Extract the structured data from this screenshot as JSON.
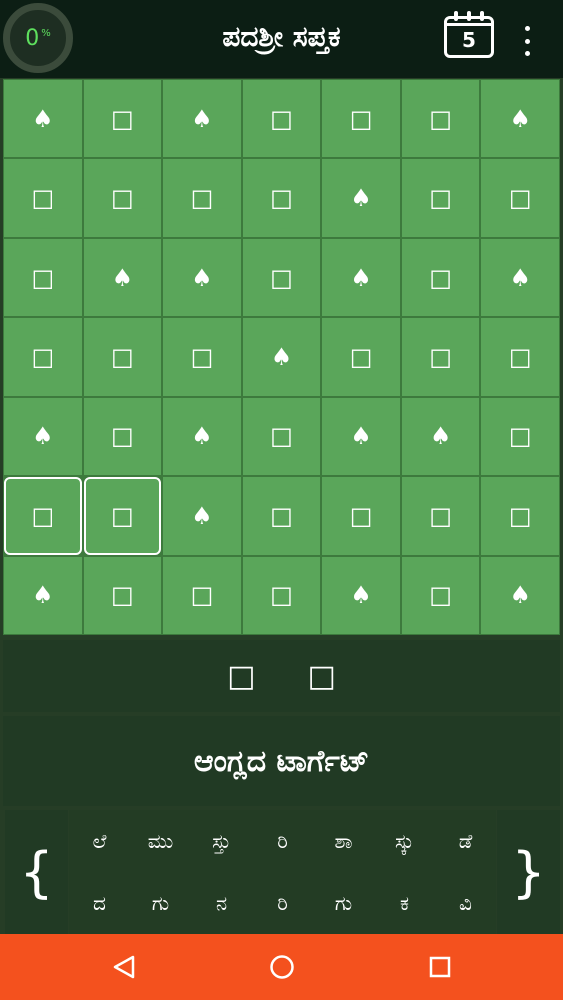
{
  "header": {
    "progress_value": "0",
    "progress_unit": "%",
    "title": "ಪದಶ್ರೀ ಸಪ್ತಕ",
    "calendar_day": "5"
  },
  "board": {
    "rows": [
      [
        "♠",
        "□",
        "♠",
        "□",
        "□",
        "□",
        "♠"
      ],
      [
        "□",
        "□",
        "□",
        "□",
        "♠",
        "□",
        "□"
      ],
      [
        "□",
        "♠",
        "♠",
        "□",
        "♠",
        "□",
        "♠"
      ],
      [
        "□",
        "□",
        "□",
        "♠",
        "□",
        "□",
        "□"
      ],
      [
        "♠",
        "□",
        "♠",
        "□",
        "♠",
        "♠",
        "□"
      ],
      [
        "□",
        "□",
        "♠",
        "□",
        "□",
        "□",
        "□"
      ],
      [
        "♠",
        "□",
        "□",
        "□",
        "♠",
        "□",
        "♠"
      ]
    ],
    "selected": [
      [
        5,
        0
      ],
      [
        5,
        1
      ]
    ]
  },
  "answer": {
    "slots": [
      "□",
      "□"
    ]
  },
  "hint": {
    "text": "ಆಂಗ್ಲದ ಟಾರ್ಗೆಟ್"
  },
  "keyboard": {
    "left_brace": "{",
    "right_brace": "}",
    "row1": [
      "ಲೆ",
      "ಮು",
      "ಸ್ತು",
      "ರಿ",
      "ಶಾ",
      "ಸ್ಕು",
      "ಡೆ"
    ],
    "row2": [
      "ದ",
      "ಗು",
      "ನ",
      "ರಿ",
      "ಗು",
      "ಕ",
      "ವಿ"
    ]
  },
  "colors": {
    "topbar": "#0c1e14",
    "cell": "#5aa65a",
    "panel": "#213a24",
    "navbar": "#f4511e",
    "progress": "#5ee05e"
  },
  "icons": {
    "calendar": "calendar-icon",
    "menu": "more-vert-icon",
    "back": "back-triangle-icon",
    "home": "home-circle-icon",
    "recents": "recents-square-icon"
  }
}
